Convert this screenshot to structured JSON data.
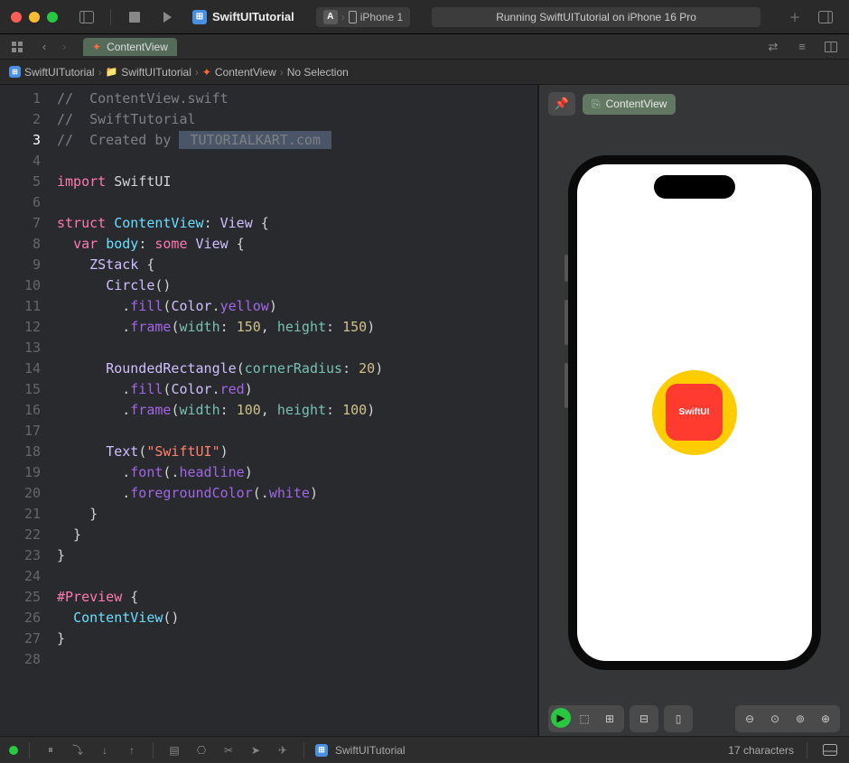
{
  "titlebar": {
    "project_name": "SwiftUITutorial",
    "device": "iPhone 1",
    "status": "Running SwiftUITutorial on iPhone 16 Pro"
  },
  "tab": {
    "name": "ContentView"
  },
  "breadcrumb": {
    "root": "SwiftUITutorial",
    "folder": "SwiftUITutorial",
    "file": "ContentView",
    "selection": "No Selection"
  },
  "code": {
    "c1": "//  ContentView.swift",
    "c2": "//  SwiftTutorial",
    "c3_prefix": "//  Created by ",
    "c3_hl": " TUTORIALKART.com ",
    "l5_import": "import",
    "l5_module": "SwiftUI",
    "l7_struct": "struct",
    "l7_name": "ContentView",
    "l7_view": "View",
    "l8_var": "var",
    "l8_body": "body",
    "l8_some": "some",
    "l8_view": "View",
    "l9_zstack": "ZStack",
    "l10_circle": "Circle",
    "l11_fill": "fill",
    "l11_color": "Color",
    "l11_yellow": "yellow",
    "l12_frame": "frame",
    "l12_w": "width",
    "l12_wv": "150",
    "l12_h": "height",
    "l12_hv": "150",
    "l14_rr": "RoundedRectangle",
    "l14_cr": "cornerRadius",
    "l14_crv": "20",
    "l15_fill": "fill",
    "l15_color": "Color",
    "l15_red": "red",
    "l16_frame": "frame",
    "l16_w": "width",
    "l16_wv": "100",
    "l16_h": "height",
    "l16_hv": "100",
    "l18_text": "Text",
    "l18_str": "\"SwiftUI\"",
    "l19_font": "font",
    "l19_head": "headline",
    "l20_fg": "foregroundColor",
    "l20_white": "white",
    "l25_prev": "#Preview",
    "l26_cv": "ContentView"
  },
  "preview": {
    "tab_name": "ContentView",
    "text": "SwiftUI"
  },
  "statusbar": {
    "project": "SwiftUITutorial",
    "chars": "17 characters"
  }
}
